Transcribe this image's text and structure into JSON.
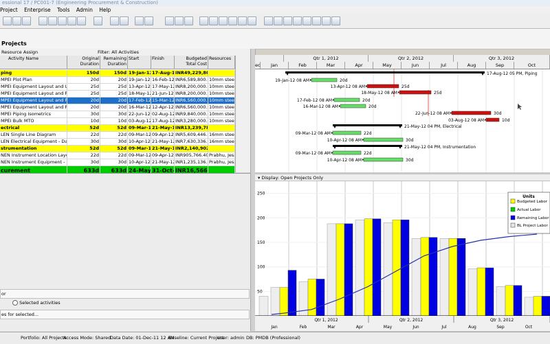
{
  "window": {
    "title": "essional 17 / PC001-7 (Engineering Procurement & Construction)"
  },
  "menu": [
    "Project",
    "Enterprise",
    "Tools",
    "Admin",
    "Help"
  ],
  "panel": {
    "title": "Projects"
  },
  "filter": {
    "left": "Resource Assign",
    "right": "Filter: All Activities"
  },
  "columns": [
    "Activity Name",
    "Original Duration",
    "Remaining Duration",
    "Start",
    "Finish",
    "Budgeted Total Cost",
    "Resources"
  ],
  "rows": [
    {
      "type": "wbs",
      "name": "ping",
      "od": "150d",
      "rd": "150d",
      "start": "19-Jan-12 0",
      "finish": "17-Aug-12 0",
      "cost": "INR49,229,800.00",
      "res": ""
    },
    {
      "type": "task",
      "name": "MPEI Plot Plan",
      "od": "20d",
      "rd": "20d",
      "start": "19-Jan-12 0",
      "finish": "16-Feb-12 0",
      "cost": "INR6,589,800.00",
      "res": "10mm steel, 1"
    },
    {
      "type": "task",
      "name": "MPEI Equipment Layout and Utility G",
      "od": "25d",
      "rd": "25d",
      "start": "13-Apr-12 0",
      "finish": "17-May-12 0",
      "cost": "INR8,200,000.00",
      "res": "10mm steel, 1"
    },
    {
      "type": "task",
      "name": "MPEI Equipment Layout and Piping G",
      "od": "25d",
      "rd": "25d",
      "start": "18-May-12 0",
      "finish": "21-Jun-12 0",
      "cost": "INR8,200,000.00",
      "res": "10mm steel, 1"
    },
    {
      "type": "sel",
      "name": "MPEI Equipment Layout and Piping G",
      "od": "20d",
      "rd": "20d",
      "start": "17-Feb-12 0",
      "finish": "15-Mar-12 0",
      "cost": "INR6,560,000.00",
      "res": "10mm steel, 1"
    },
    {
      "type": "task",
      "name": "MPEI Equipment Layout and Piping G",
      "od": "20d",
      "rd": "20d",
      "start": "16-Mar-12 0",
      "finish": "12-Apr-12 0",
      "cost": "INR6,560,000.00",
      "res": "10mm steel, 1"
    },
    {
      "type": "task",
      "name": "MPEI Piping Isometrics",
      "od": "30d",
      "rd": "30d",
      "start": "22-Jun-12 0",
      "finish": "02-Aug-12 0",
      "cost": "INR9,840,000.00",
      "res": "10mm steel, 1"
    },
    {
      "type": "task",
      "name": "MPEI Bulk MTO",
      "od": "10d",
      "rd": "10d",
      "start": "03-Aug-12 0",
      "finish": "17-Aug-12 0",
      "cost": "INR3,280,000.00",
      "res": "10mm steel, 1"
    },
    {
      "type": "wbs",
      "name": "ectrical",
      "od": "52d",
      "rd": "52d",
      "start": "09-Mar-12 0",
      "finish": "21-May-12 0",
      "cost": "INR13,239,782.40",
      "res": ""
    },
    {
      "type": "task",
      "name": "LEN Single Line Diagram",
      "od": "22d",
      "rd": "22d",
      "start": "09-Mar-12 0",
      "finish": "09-Apr-12 0",
      "cost": "INR5,609,446.40",
      "res": "16mm steel, V"
    },
    {
      "type": "task",
      "name": "LEN Electrical Equipment - Datashee",
      "od": "30d",
      "rd": "30d",
      "start": "10-Apr-12 0",
      "finish": "21-May-12 0",
      "cost": "INR7,630,336.00",
      "res": "16mm steel, V"
    },
    {
      "type": "wbs",
      "name": "strumentation",
      "od": "52d",
      "rd": "52d",
      "start": "09-Mar-12 0",
      "finish": "21-May-12 0",
      "cost": "INR2,140,902.40",
      "res": ""
    },
    {
      "type": "task",
      "name": "NEN Instrument Location Layout",
      "od": "22d",
      "rd": "22d",
      "start": "09-Mar-12 0",
      "finish": "09-Apr-12 0",
      "cost": "INR905,766.40",
      "res": "Prabhu, Jesa"
    },
    {
      "type": "task",
      "name": "NEN Instrument Equipment - Datashe",
      "od": "30d",
      "rd": "30d",
      "start": "10-Apr-12 0",
      "finish": "21-May-12 0",
      "cost": "INR1,235,136.00",
      "res": "Prabhu, Jesa"
    },
    {
      "type": "grand",
      "name": "curement",
      "od": "633d",
      "rd": "633d",
      "start": "24-May-12 0",
      "finish": "31-Oct-14 0",
      "cost": "INR16,566,800.00",
      "res": ""
    }
  ],
  "lower_left": {
    "field": "or",
    "option": "Selected activities",
    "for": "es for selected..."
  },
  "gantt": {
    "quarters": [
      "Qtr 1, 2012",
      "Qtr 2, 2012",
      "Qtr 3, 2012"
    ],
    "months": [
      "ec",
      "Jan",
      "Feb",
      "Mar",
      "Apr",
      "May",
      "Jun",
      "Jul",
      "Aug",
      "Sep",
      "Oct"
    ],
    "bars": [
      {
        "label": "17-Aug-12 05 PM, Piping",
        "start_label": "",
        "dur": ""
      },
      {
        "label": "",
        "start_label": "19-Jan-12 08 AM",
        "dur": "20d"
      },
      {
        "label": "",
        "start_label": "13-Apr-12 08 AM",
        "dur": "25d"
      },
      {
        "label": "",
        "start_label": "18-May-12 08 AM",
        "dur": "25d"
      },
      {
        "label": "",
        "start_label": "17-Feb-12 08 AM",
        "dur": "20d"
      },
      {
        "label": "",
        "start_label": "16-Mar-12 08 AM",
        "dur": "20d"
      },
      {
        "label": "",
        "start_label": "22-Jun-12 08 AM",
        "dur": "30d"
      },
      {
        "label": "",
        "start_label": "03-Aug-12 08 AM",
        "dur": "10d"
      },
      {
        "label": "21-May-12 04 PM, Electrical",
        "start_label": "",
        "dur": ""
      },
      {
        "label": "",
        "start_label": "09-Mar-12 08 AM",
        "dur": "22d"
      },
      {
        "label": "",
        "start_label": "10-Apr-12 08 AM",
        "dur": "30d"
      },
      {
        "label": "21-May-12 04 PM, Instrumentation",
        "start_label": "",
        "dur": ""
      },
      {
        "label": "",
        "start_label": "09-Mar-12 08 AM",
        "dur": "22d"
      },
      {
        "label": "",
        "start_label": "10-Apr-12 08 AM",
        "dur": "30d"
      }
    ]
  },
  "display": {
    "label": "Display: Open Projects Only"
  },
  "chart_data": {
    "type": "bar",
    "title": "",
    "ylim": [
      0,
      250
    ],
    "yticks": [
      "250",
      "200",
      "150",
      "100",
      "50"
    ],
    "xlabels_months": [
      "Jan",
      "Feb",
      "Mar",
      "Apr",
      "May",
      "Jun",
      "Jul",
      "Aug",
      "Sep",
      "Oct"
    ],
    "xlabels_quarters": [
      "Qtr 1, 2012",
      "Qtr 2, 2012",
      "Qtr 3, 2012"
    ],
    "legend_title": "Units",
    "legend_position": "top-right",
    "categories": [
      "Dec",
      "Jan",
      "Feb",
      "Mar",
      "Apr",
      "May",
      "Jun",
      "Jul",
      "Aug",
      "Sep",
      "Oct"
    ],
    "series": [
      {
        "name": "Budgeted Labor",
        "color": "#ffff00",
        "values": [
          0,
          58,
          75,
          188,
          198,
          196,
          160,
          158,
          98,
          62,
          40
        ]
      },
      {
        "name": "Actual Labor",
        "color": "#00cc00",
        "values": [
          0,
          0,
          0,
          0,
          0,
          0,
          0,
          0,
          0,
          0,
          0
        ]
      },
      {
        "name": "Remaining Labor",
        "color": "#0000e0",
        "values": [
          0,
          93,
          75,
          188,
          198,
          196,
          160,
          158,
          98,
          62,
          40
        ]
      },
      {
        "name": "BL Project Labor",
        "color": "#e8e8e8",
        "values": [
          40,
          58,
          70,
          188,
          196,
          190,
          158,
          158,
          96,
          60,
          38
        ]
      }
    ],
    "cumulative_line": {
      "color": "#2233aa",
      "values": [
        0,
        2,
        8,
        25,
        45,
        70,
        95,
        110,
        120,
        126,
        130
      ]
    }
  },
  "status": {
    "portfolio": "Portfolio: All Projects",
    "access": "Access Mode: Shared",
    "datadate": "Data Date: 01-Dec-11 12 AM",
    "baseline": "Baseline: Current Project",
    "user": "User: admin",
    "db": "DB: PMDB (Professional)"
  }
}
